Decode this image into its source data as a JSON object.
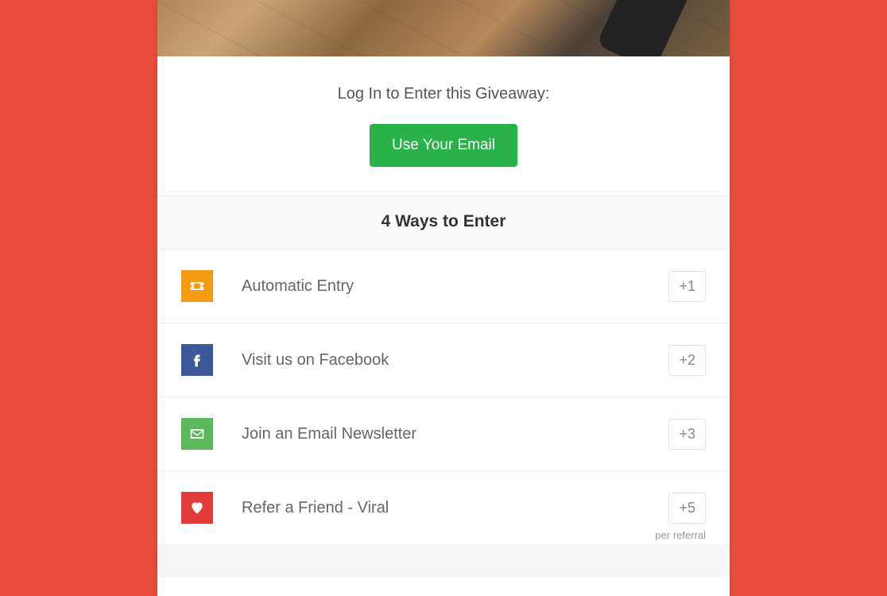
{
  "login": {
    "title": "Log In to Enter this Giveaway:",
    "email_button": "Use Your Email"
  },
  "ways_header": "4 Ways to Enter",
  "entries": [
    {
      "label": "Automatic Entry",
      "points": "+1",
      "note": ""
    },
    {
      "label": "Visit us on Facebook",
      "points": "+2",
      "note": ""
    },
    {
      "label": "Join an Email Newsletter",
      "points": "+3",
      "note": ""
    },
    {
      "label": "Refer a Friend - Viral",
      "points": "+5",
      "note": "per referral"
    }
  ]
}
